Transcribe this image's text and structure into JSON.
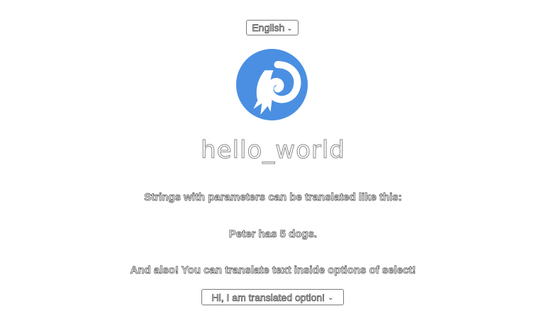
{
  "language_select": {
    "selected": "English"
  },
  "logo": {
    "icon": "comet-logo-icon",
    "circle_color": "#4a8fe2",
    "mark_color": "#ffffff"
  },
  "title": "hello_world",
  "lines": {
    "params_intro": "Strings with parameters can be translated like this:",
    "params_example": "Peter has 5 dogs.",
    "options_intro": "And also! You can translate text inside options of select!"
  },
  "option_select": {
    "selected": "Hi, I am translated option!"
  }
}
